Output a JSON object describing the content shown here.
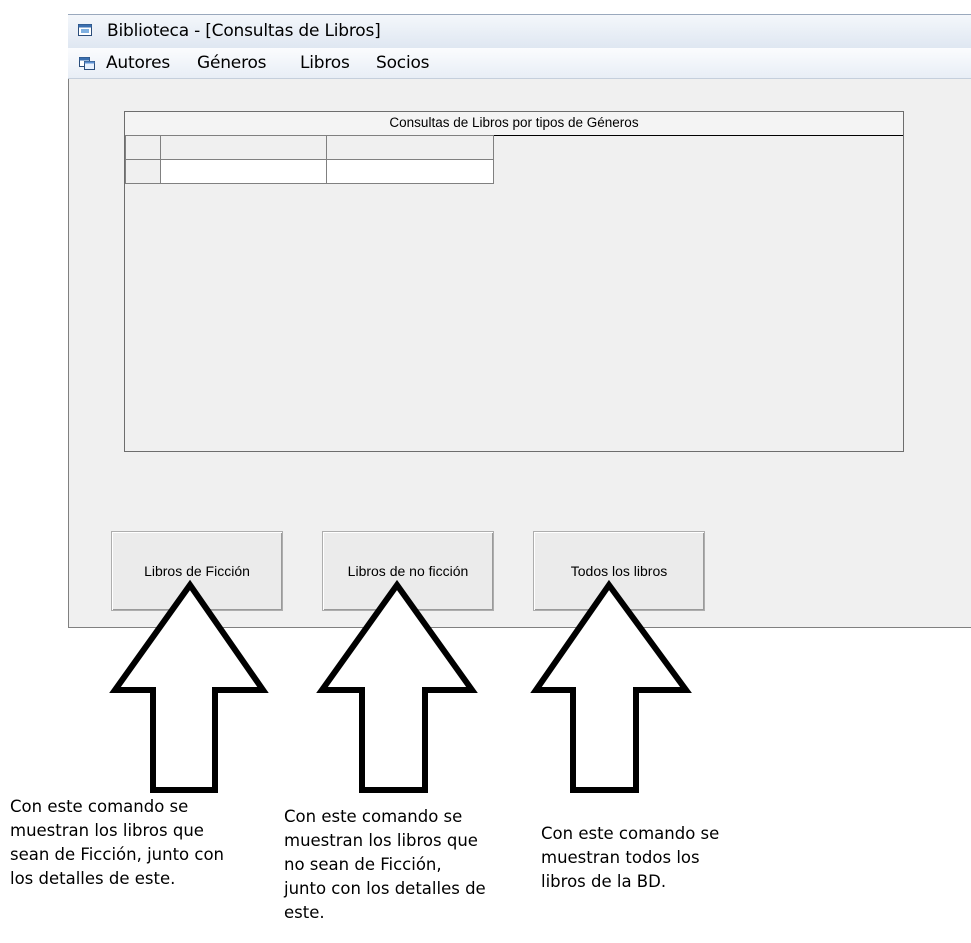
{
  "window": {
    "title": "Biblioteca - [Consultas de Libros]",
    "title_icon": "app-window-icon"
  },
  "menubar": {
    "icon": "mdi-child-window-icon",
    "items": [
      "Autores",
      "Géneros",
      "Libros",
      "Socios"
    ]
  },
  "grid": {
    "caption": "Consultas de Libros por tipos de Géneros"
  },
  "buttons": {
    "fiction": "Libros de Ficción",
    "nonfiction": "Libros de no ficción",
    "all": "Todos los libros"
  },
  "annotations": {
    "fiction": "Con este comando se\nmuestran los libros que\nsean de Ficción, junto con\nlos detalles de este.",
    "nonfiction": "Con este comando se\nmuestran los libros que\nno sean de Ficción,\njunto con los detalles de\neste.",
    "all": "Con este comando se\nmuestran todos los\nlibros de la BD."
  },
  "colors": {
    "form_background": "#f0f0f0",
    "titlebar_gradient_start": "#f4f7fb",
    "titlebar_gradient_end": "#dfe7f2"
  }
}
